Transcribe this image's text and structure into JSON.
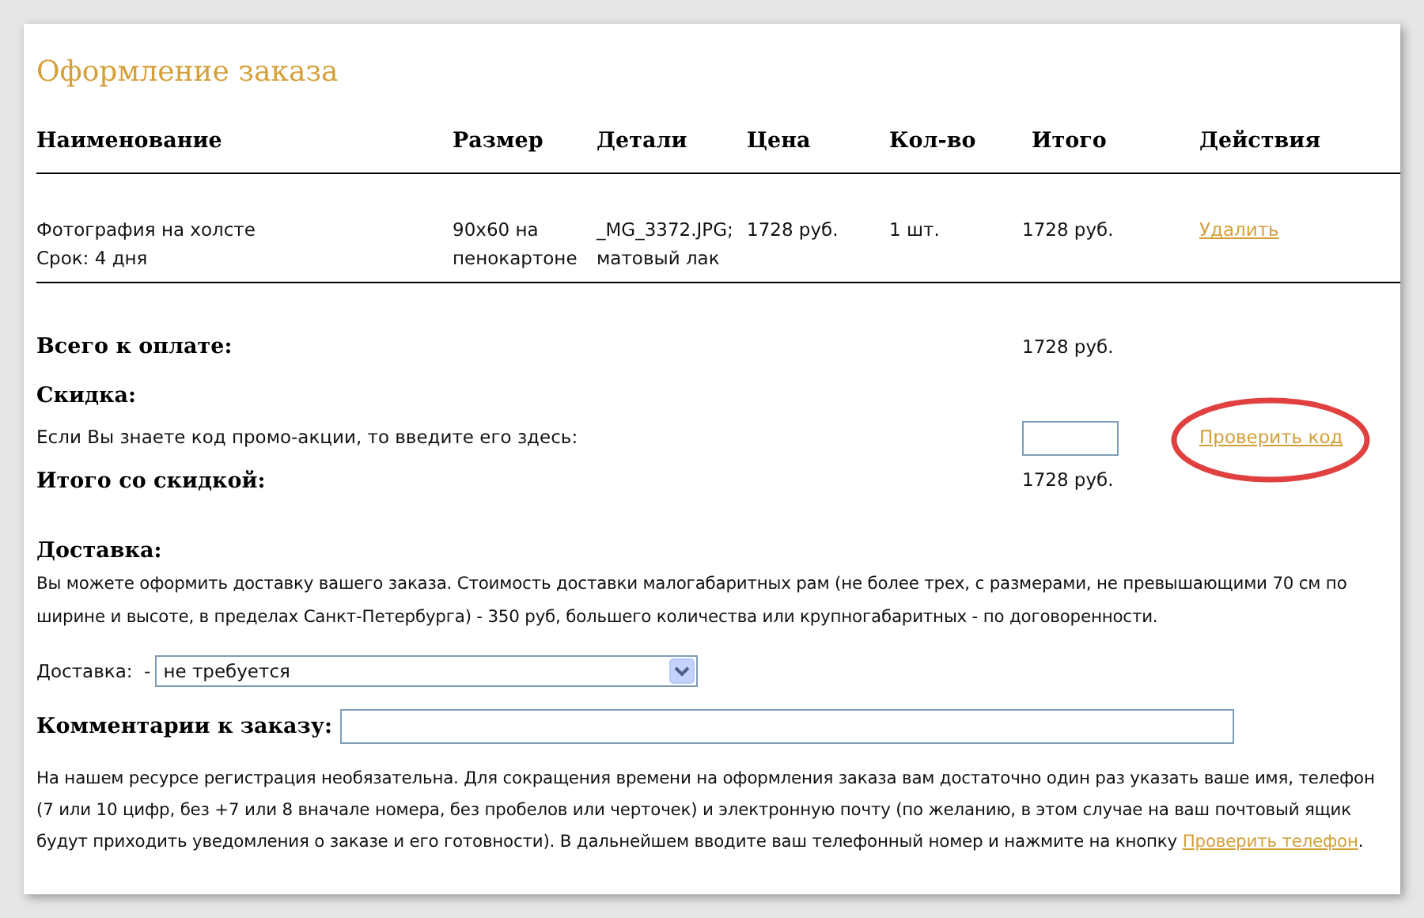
{
  "title": "Оформление заказа",
  "table": {
    "columns": [
      "Наименование",
      "Размер",
      "Детали",
      "Цена",
      "Кол-во",
      "Итого",
      "Действия"
    ],
    "rows": [
      {
        "name": [
          "Фотография  на холсте",
          "Срок: 4 дня"
        ],
        "size": [
          "90x60 на",
          "пенокартоне"
        ],
        "details": [
          "_MG_3372.JPG;",
          "матовый лак"
        ],
        "price": "1728 руб.",
        "qty": "1 шт.",
        "total": "1728 руб.",
        "action": "Удалить"
      }
    ]
  },
  "summary": {
    "total_label": "Всего к оплате:",
    "total_value": "1728 руб.",
    "discount_label": "Скидка:",
    "promo_text": "Если Вы знаете код промо-акции, то введите его здесь:",
    "check_code": {
      "label": "Проверить код",
      "circled": true
    },
    "final_label": "Итого со скидкой:",
    "final_value": "1728 руб."
  },
  "delivery": {
    "heading": "Доставка:",
    "text": "Вы можете оформить доставку вашего заказа. Стоимость доставки малогабаритных рам (не более трех, с размерами, не превышающими 70 см по ширине и высоте, в пределах Санкт-Петербурга) - 350 руб, большего количества или крупногабаритных - по договоренности.",
    "select_label": "Доставка:  -",
    "select_value": "не требуется"
  },
  "comments": {
    "label": "Комментарии к заказу:"
  },
  "note": {
    "text": "На нашем ресурсе регистрация необязательна. Для сокращения времени на оформления заказа вам достаточно один раз указать ваше имя, телефон (7 или 10 цифр, без +7 или 8 вначале номера, без пробелов или черточек) и электронную почту (по желанию, в этом случае на ваш почтовый ящик будут приходить уведомления о заказе и его готовности). В дальнейшем вводите ваш телефонный номер и нажмите на кнопку",
    "link": "Проверить телефон",
    "after": "."
  }
}
